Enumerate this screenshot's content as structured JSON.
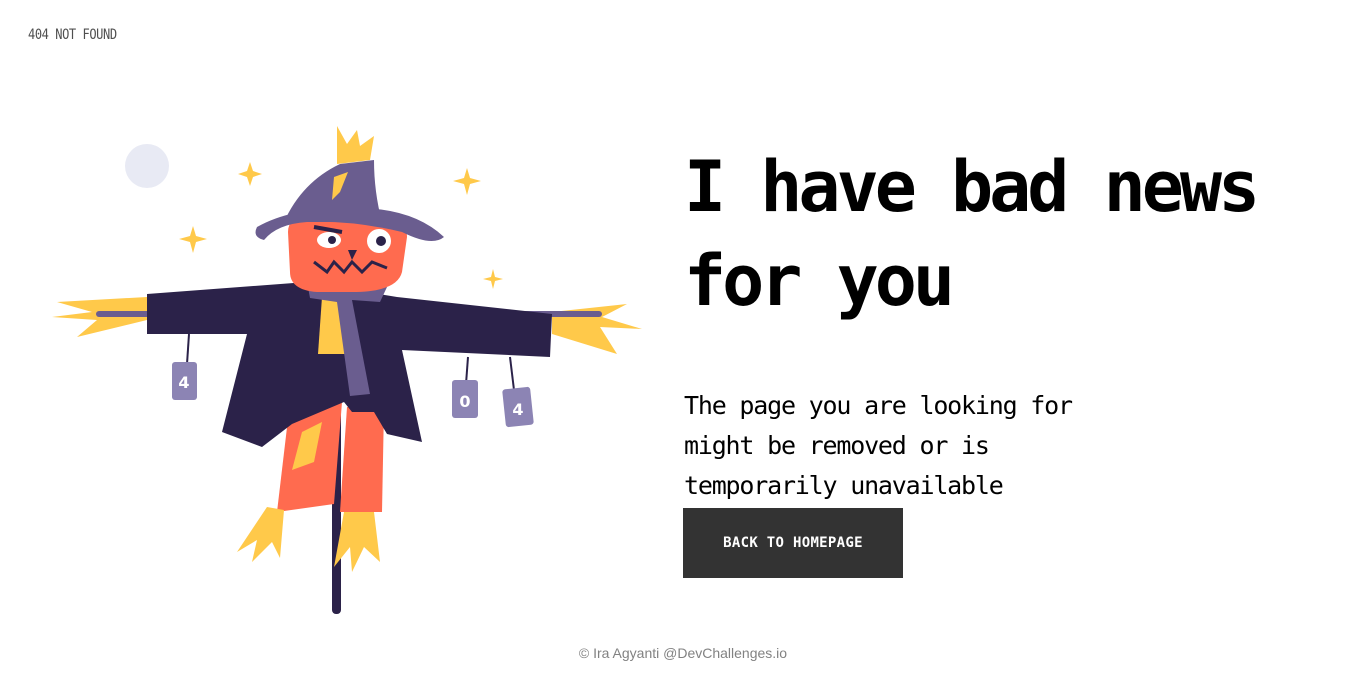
{
  "header": {
    "label": "404 NOT FOUND"
  },
  "main": {
    "headline": "I have bad news for you",
    "message": "The page you are looking for might be removed or is temporarily unavailable",
    "button_label": "BACK TO HOMEPAGE"
  },
  "illustration": {
    "can_labels": [
      "4",
      "0",
      "4"
    ],
    "colors": {
      "hat": "#6a5d8f",
      "face": "#ff6b4f",
      "coat": "#2b2249",
      "straw": "#ffc94a",
      "pants": "#ff6b4f",
      "can": "#8c84b4",
      "moon": "#e8eaf4"
    }
  },
  "footer": {
    "credit": "© Ira Agyanti @DevChallenges.io"
  }
}
